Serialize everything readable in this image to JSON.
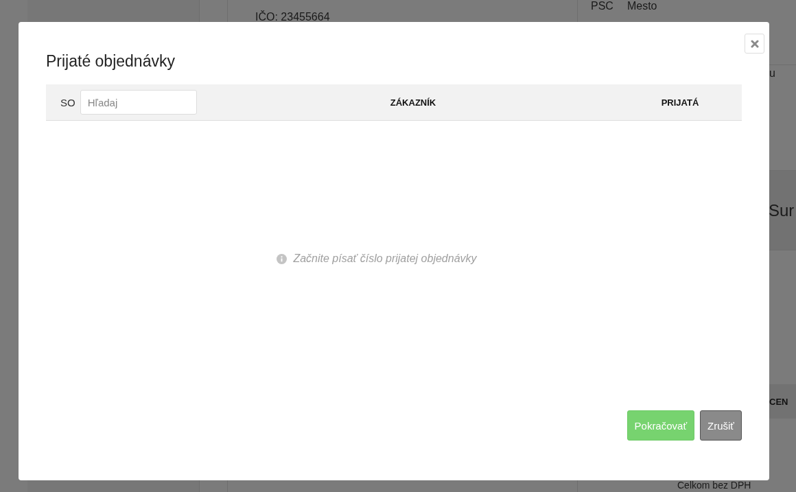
{
  "background": {
    "company_id": "IČO: 23455664",
    "columns": [
      "PSC",
      "Mesto"
    ],
    "label_partial": "u",
    "heading_partial": "Sur",
    "header_partial": "CEN",
    "total_label": "Celkom bez DPH"
  },
  "dialog": {
    "title": "Prijaté objednávky",
    "table": {
      "search_label": "SO",
      "search": {
        "placeholder": "Hľadaj"
      },
      "columns": [
        "ZÁKAZNÍK",
        "PRIJATÁ"
      ]
    },
    "empty_message": "Začnite písať číslo prijatej objednávky",
    "buttons": [
      {
        "label": "Pokračovať",
        "kind": "primary"
      },
      {
        "label": "Zrušiť",
        "kind": "secondary"
      }
    ]
  }
}
